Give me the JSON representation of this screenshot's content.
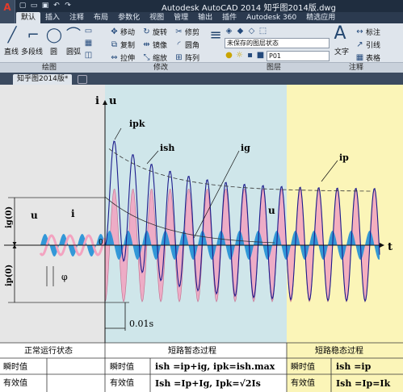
{
  "app": {
    "title": "Autodesk AutoCAD 2014    知乎图2014版.dwg",
    "logo": "A",
    "tabs": [
      "默认",
      "插入",
      "注释",
      "布局",
      "参数化",
      "视图",
      "管理",
      "输出",
      "插件",
      "Autodesk 360",
      "精选应用"
    ]
  },
  "ribbon": {
    "draw": {
      "line": "直线",
      "polyline": "多段线",
      "circle": "圆",
      "arc": "圆弧",
      "panel": "绘图"
    },
    "modify": {
      "move": "移动",
      "rotate": "旋转",
      "trim": "修剪",
      "copy": "复制",
      "mirror": "镜像",
      "fillet": "圆角",
      "stretch": "拉伸",
      "scale": "缩放",
      "array": "阵列",
      "panel": "修改"
    },
    "layers": {
      "state": "未保存的图层状态",
      "layer": "P01",
      "panel": "图层"
    },
    "annotation": {
      "text": "文字",
      "dim": "标注",
      "leader": "引线",
      "table": "表格",
      "panel": "注释"
    }
  },
  "document": {
    "tab": "知乎图2014版*"
  },
  "drawing": {
    "axis_i": "i",
    "axis_u": "u",
    "axis_t": "t",
    "label_ipk": "ipk",
    "label_ish": "ish",
    "label_ig": "ig",
    "label_ip": "ip",
    "label_u_left": "u",
    "label_i_left": "i",
    "label_u_right": "u",
    "label_ig0": "ig(0)",
    "label_ip0": "ip(0)",
    "label_phi": "φ",
    "label_zero": "0",
    "label_time": "0.01s",
    "state_normal": "正常运行状态",
    "state_transient": "短路暂态过程",
    "state_steady": "短路稳态过程",
    "row1_label": "瞬时值",
    "row2_label": "有效值",
    "row1_mid_label": "瞬时值",
    "row2_mid_label": "有效值",
    "row1_mid_formula": "ish =ip+ig, ipk=ish.max",
    "row2_mid_formula": "Ish =Ip+Ig, Ipk=√2Is",
    "row1_right_label": "瞬时值",
    "row2_right_label": "有效值",
    "row1_right_formula": "ish =ip",
    "row2_right_formula": "Ish =Ip=Ik",
    "colors": {
      "left_bg": "#e6e6e6",
      "mid_bg": "#cfe6ea",
      "right_bg": "#fbf5b8",
      "pink": "#f3a3c0",
      "blue": "#1f8fd6",
      "curve": "#1c1c8c"
    }
  }
}
